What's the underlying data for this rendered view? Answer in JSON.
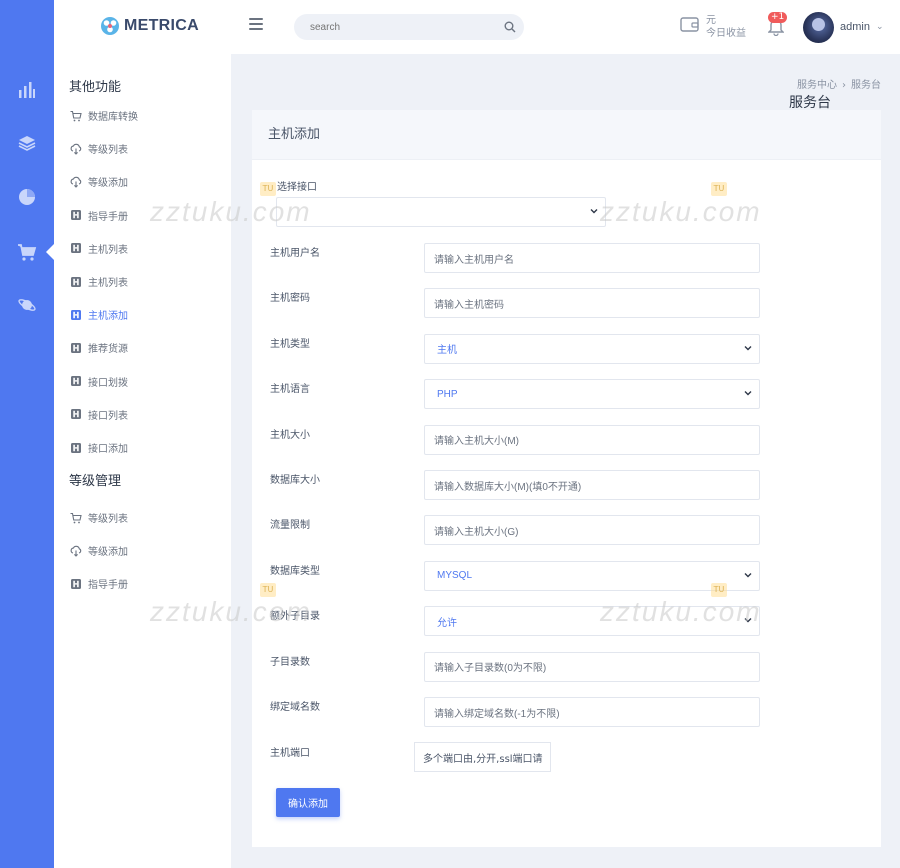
{
  "brand": {
    "name": "METRICA"
  },
  "header": {
    "search_placeholder": "search",
    "wallet_unit": "元",
    "wallet_label": "今日收益",
    "notification_badge": "+1",
    "user_name": "admin"
  },
  "sidebar": {
    "groups": [
      {
        "title": "其他功能",
        "items": [
          {
            "label": "数据库转换",
            "icon": "cart-icon"
          },
          {
            "label": "等级列表",
            "icon": "cloud-download-icon"
          },
          {
            "label": "等级添加",
            "icon": "cloud-download-icon"
          },
          {
            "label": "指导手册",
            "icon": "book-icon"
          },
          {
            "label": "主机列表",
            "icon": "book-icon"
          },
          {
            "label": "主机列表",
            "icon": "book-icon"
          },
          {
            "label": "主机添加",
            "icon": "book-icon",
            "active": true
          },
          {
            "label": "推荐货源",
            "icon": "book-icon"
          },
          {
            "label": "接口划拨",
            "icon": "book-icon"
          },
          {
            "label": "接口列表",
            "icon": "book-icon"
          },
          {
            "label": "接口添加",
            "icon": "book-icon"
          }
        ]
      },
      {
        "title": "等级管理",
        "items": [
          {
            "label": "等级列表",
            "icon": "cart-icon"
          },
          {
            "label": "等级添加",
            "icon": "cloud-download-icon"
          },
          {
            "label": "指导手册",
            "icon": "book-icon"
          }
        ]
      }
    ]
  },
  "breadcrumb": {
    "parent": "服务中心",
    "current": "服务台"
  },
  "page_title": "服务台",
  "card": {
    "title": "主机添加",
    "interface_label": "选择接口",
    "fields": [
      {
        "label": "主机用户名",
        "placeholder": "请输入主机用户名",
        "type": "input"
      },
      {
        "label": "主机密码",
        "placeholder": "请输入主机密码",
        "type": "input"
      },
      {
        "label": "主机类型",
        "value": "主机",
        "type": "select"
      },
      {
        "label": "主机语言",
        "value": "PHP",
        "type": "select"
      },
      {
        "label": "主机大小",
        "placeholder": "请输入主机大小(M)",
        "type": "input"
      },
      {
        "label": "数据库大小",
        "placeholder": "请输入数据库大小(M)(填0不开通)",
        "type": "input"
      },
      {
        "label": "流量限制",
        "placeholder": "请输入主机大小(G)",
        "type": "input"
      },
      {
        "label": "数据库类型",
        "value": "MYSQL",
        "type": "select"
      },
      {
        "label": "额外子目录",
        "value": "允许",
        "type": "select"
      },
      {
        "label": "子目录数",
        "placeholder": "请输入子目录数(0为不限)",
        "type": "input"
      },
      {
        "label": "绑定域名数",
        "placeholder": "请输入绑定域名数(-1为不限)",
        "type": "input"
      }
    ],
    "port_label": "主机端口",
    "port_value": "多个端口由,分开,ssl端口请",
    "submit_label": "确认添加"
  },
  "watermark": {
    "text": "zztuku.com",
    "tag": "TU"
  },
  "colors": {
    "primary": "#4f78f0",
    "badge": "#f05b5b"
  }
}
